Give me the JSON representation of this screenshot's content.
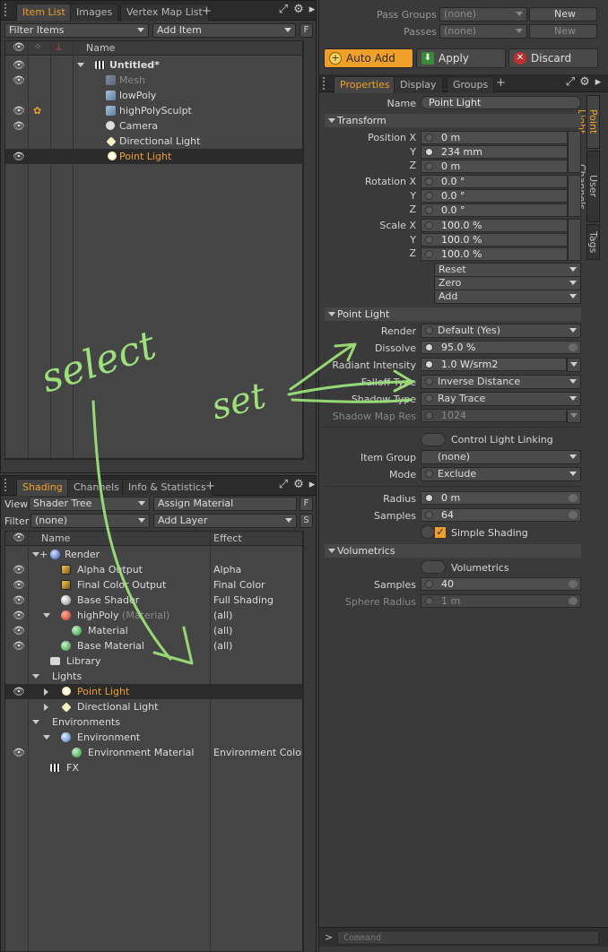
{
  "top_panel": {
    "tabs": [
      "Item List",
      "Images",
      "Vertex Map List"
    ],
    "filter": "Filter Items",
    "add_item": "Add Item",
    "f_btn": "F",
    "header_name": "Name",
    "items": [
      {
        "name": "Untitled*",
        "bold": true
      },
      {
        "name": "Mesh",
        "dim": true
      },
      {
        "name": "lowPoly"
      },
      {
        "name": "highPolySculpt"
      },
      {
        "name": "Camera"
      },
      {
        "name": "Directional Light"
      },
      {
        "name": "Point Light",
        "selected": true
      }
    ]
  },
  "bottom_panel": {
    "tabs": [
      "Shading",
      "Channels",
      "Info & Statistics"
    ],
    "view_label": "View",
    "view_value": "Shader Tree",
    "assign_material": "Assign Material",
    "filter_label": "Filter",
    "filter_value": "(none)",
    "add_layer": "Add Layer",
    "f_btn": "F",
    "s_btn": "S",
    "col_name": "Name",
    "col_effect": "Effect",
    "rows": [
      {
        "name": "Render",
        "effect": ""
      },
      {
        "name": "Alpha Output",
        "effect": "Alpha"
      },
      {
        "name": "Final Color Output",
        "effect": "Final Color"
      },
      {
        "name": "Base Shader",
        "effect": "Full Shading"
      },
      {
        "name": "highPoly",
        "suffix": "(Material)",
        "effect": "(all)"
      },
      {
        "name": "Material",
        "effect": "(all)"
      },
      {
        "name": "Base Material",
        "effect": "(all)"
      },
      {
        "name": "Library",
        "effect": ""
      },
      {
        "name": "Lights",
        "effect": ""
      },
      {
        "name": "Point Light",
        "effect": "",
        "selected": true
      },
      {
        "name": "Directional Light",
        "effect": ""
      },
      {
        "name": "Environments",
        "effect": ""
      },
      {
        "name": "Environment",
        "effect": ""
      },
      {
        "name": "Environment Material",
        "effect": "Environment Color"
      },
      {
        "name": "FX",
        "effect": ""
      }
    ]
  },
  "right_panel": {
    "pass_groups_label": "Pass Groups",
    "pass_groups_value": "(none)",
    "passes_label": "Passes",
    "passes_value": "(none)",
    "new_label": "New",
    "auto_add": "Auto Add",
    "apply": "Apply",
    "discard": "Discard",
    "tabs": [
      "Properties",
      "Display",
      "Groups"
    ],
    "vtabs": [
      "Point Light",
      "User Channels",
      "Tags"
    ],
    "name_label": "Name",
    "name_value": "Point Light",
    "transform_section": "Transform",
    "position_label": "Position X",
    "rotation_label": "Rotation X",
    "scale_label": "Scale X",
    "y_label": "Y",
    "z_label": "Z",
    "position": [
      "0 m",
      "234 mm",
      "0 m"
    ],
    "rotation": [
      "0.0 °",
      "0.0 °",
      "0.0 °"
    ],
    "scale": [
      "100.0 %",
      "100.0 %",
      "100.0 %"
    ],
    "reset": "Reset",
    "zero": "Zero",
    "add": "Add",
    "point_light_section": "Point Light",
    "render_label": "Render",
    "render_value": "Default (Yes)",
    "dissolve_label": "Dissolve",
    "dissolve_value": "95.0 %",
    "radiant_label": "Radiant Intensity",
    "radiant_value": "1.0 W/srm2",
    "falloff_label": "Falloff Type",
    "falloff_value": "Inverse Distance",
    "shadow_type_label": "Shadow Type",
    "shadow_type_value": "Ray Trace",
    "shadow_map_label": "Shadow Map Res",
    "shadow_map_value": "1024",
    "control_linking": "Control Light Linking",
    "item_group_label": "Item Group",
    "item_group_value": "(none)",
    "mode_label": "Mode",
    "mode_value": "Exclude",
    "radius_label": "Radius",
    "radius_value": "0 m",
    "samples_label": "Samples",
    "samples_value": "64",
    "simple_shading": "Simple Shading",
    "volumetrics_section": "Volumetrics",
    "volumetrics_toggle": "Volumetrics",
    "vol_samples_label": "Samples",
    "vol_samples_value": "40",
    "sphere_radius_label": "Sphere Radius",
    "sphere_radius_value": "1 m",
    "command_placeholder": "Command",
    "prompt": ">"
  },
  "annotations": {
    "select": "select",
    "set": "set",
    "color": "#9be07a"
  },
  "colors": {
    "accent": "#f0a028",
    "background": "#3a3a3a"
  }
}
